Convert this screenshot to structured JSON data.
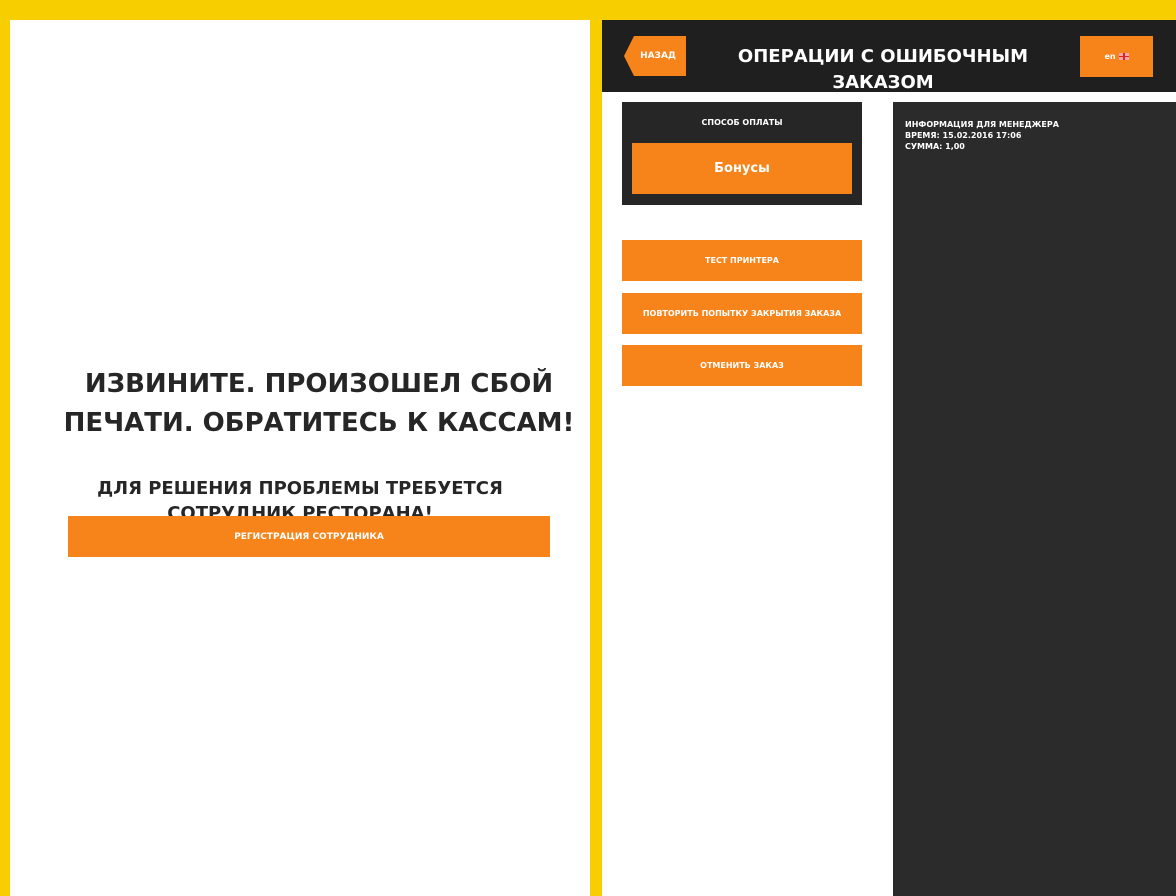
{
  "error_screen": {
    "title": "ИЗВИНИТЕ. ПРОИЗОШЕЛ СБОЙ\nПЕЧАТИ. ОБРАТИТЕСЬ К КАССАМ!",
    "subtitle": "ДЛЯ РЕШЕНИЯ ПРОБЛЕМЫ ТРЕБУЕТСЯ\nСОТРУДНИК РЕСТОРАНА!",
    "staff_button": "РЕГИСТРАЦИЯ СОТРУДНИКА"
  },
  "header": {
    "back_label": "НАЗАД",
    "title": "ОПЕРАЦИИ С ОШИБОЧНЫМ ЗАКАЗОМ",
    "language_label": "en",
    "language_icon": "uk-flag-icon"
  },
  "payment": {
    "label": "СПОСОБ ОПЛАТЫ",
    "selected": "Бонусы"
  },
  "actions": [
    "ТЕСТ ПРИНТЕРА",
    "ПОВТОРИТЬ ПОПЫТКУ ЗАКРЫТИЯ ЗАКАЗА",
    "ОТМЕНИТЬ ЗАКАЗ"
  ],
  "manager_info": {
    "heading": "ИНФОРМАЦИЯ ДЛЯ МЕНЕДЖЕРА",
    "time": "ВРЕМЯ: 15.02.2016 17:06",
    "sum": "СУММА: 1,00"
  },
  "colors": {
    "frame": "#f7ce00",
    "accent": "#f7841a",
    "dark": "#262626"
  }
}
